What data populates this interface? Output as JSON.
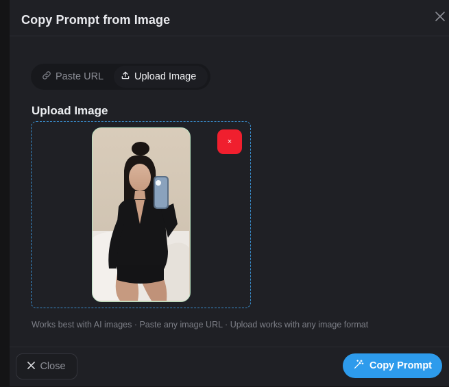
{
  "dialog": {
    "title": "Copy Prompt from Image",
    "close_icon": "close-icon"
  },
  "tabs": [
    {
      "label": "Paste URL",
      "icon": "link-icon",
      "active": false
    },
    {
      "label": "Upload Image",
      "icon": "upload-icon",
      "active": true
    }
  ],
  "upload": {
    "section_label": "Upload Image",
    "remove_label": "×",
    "preview_alt": "uploaded image preview"
  },
  "hint": "Works best with AI images · Paste any image URL · Upload works with any image format",
  "footer": {
    "close_label": "Close",
    "copy_label": "Copy Prompt"
  },
  "colors": {
    "accent": "#2d9bec",
    "danger": "#f01f2e",
    "dropzone_border": "#3a8fd0",
    "preview_border": "#b9e2c0"
  }
}
